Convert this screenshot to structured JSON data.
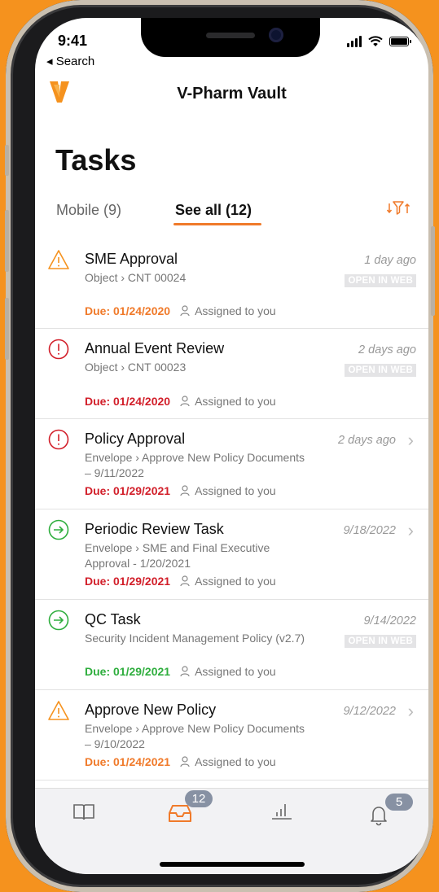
{
  "status_bar": {
    "time": "9:41",
    "back_label": "◂ Search"
  },
  "app": {
    "title": "V-Pharm Vault",
    "accent": "#f07a2a"
  },
  "page": {
    "title": "Tasks"
  },
  "tabs": [
    {
      "label": "Mobile (9)",
      "active": false
    },
    {
      "label": "See all (12)",
      "active": true
    }
  ],
  "tasks": [
    {
      "name": "SME Approval",
      "path": "Object › CNT 00024",
      "when": "1 day ago",
      "action": "OPEN IN WEB",
      "due": "Due: 01/24/2020",
      "due_color": "orange",
      "assigned": "Assigned to you",
      "icon": "warning-icon"
    },
    {
      "name": "Annual Event Review",
      "path": "Object › CNT 00023",
      "when": "2 days ago",
      "action": "OPEN IN WEB",
      "due": "Due: 01/24/2020",
      "due_color": "red",
      "assigned": "Assigned to you",
      "icon": "alert-circle-icon"
    },
    {
      "name": "Policy Approval",
      "path": "Envelope › Approve New Policy Documents – 9/11/2022",
      "when": "2 days ago",
      "action": "",
      "due": "Due: 01/29/2021",
      "due_color": "red",
      "assigned": "Assigned to you",
      "icon": "alert-circle-icon"
    },
    {
      "name": "Periodic Review Task",
      "path": "Envelope › SME and Final Executive Approval - 1/20/2021",
      "when": "9/18/2022",
      "action": "",
      "due": "Due: 01/29/2021",
      "due_color": "red",
      "assigned": "Assigned to you",
      "icon": "arrow-circle-icon"
    },
    {
      "name": "QC Task",
      "path": "Security Incident Management Policy (v2.7)",
      "when": "9/14/2022",
      "action": "OPEN IN WEB",
      "due": "Due: 01/29/2021",
      "due_color": "green",
      "assigned": "Assigned to you",
      "icon": "arrow-circle-icon"
    },
    {
      "name": "Approve New Policy",
      "path": "Envelope › Approve New Policy Documents – 9/10/2022",
      "when": "9/12/2022",
      "action": "",
      "due": "Due: 01/24/2021",
      "due_color": "orange",
      "assigned": "Assigned to you",
      "icon": "warning-icon"
    }
  ],
  "tabbar": {
    "items": [
      {
        "icon": "library-book-icon"
      },
      {
        "icon": "inbox-tray-icon",
        "badge": "12"
      },
      {
        "icon": "bar-chart-icon"
      },
      {
        "icon": "bell-icon",
        "badge": "5"
      }
    ]
  }
}
